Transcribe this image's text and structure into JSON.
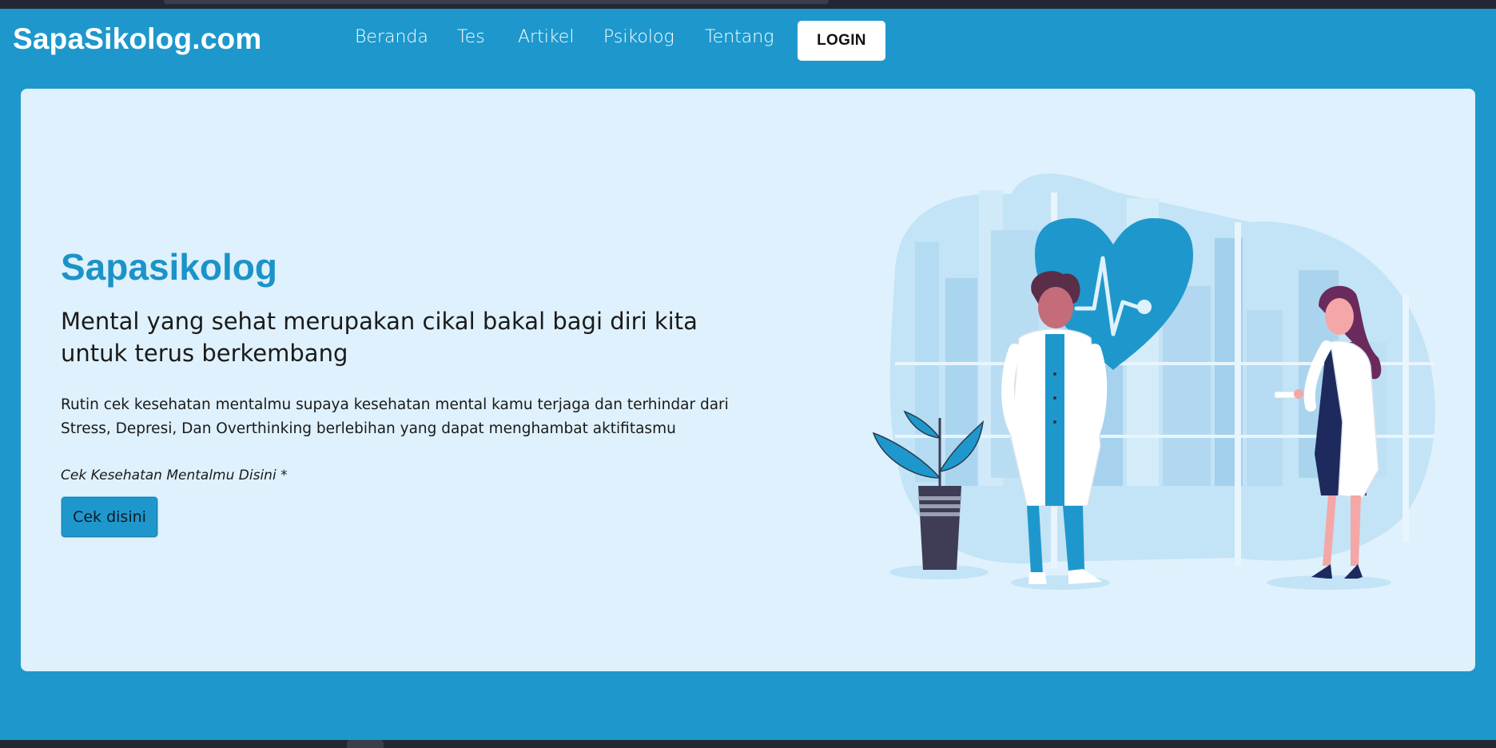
{
  "header": {
    "brand": "SapaSikolog.com",
    "nav": [
      "Beranda",
      "Tes",
      "Artikel",
      "Psikolog",
      "Tentang"
    ],
    "login_label": "LOGIN"
  },
  "hero": {
    "title": "Sapasikolog",
    "subtitle": "Mental yang sehat merupakan cikal bakal bagi diri kita untuk terus berkembang",
    "description": "Rutin cek kesehatan mentalmu supaya kesehatan mental kamu terjaga dan terhindar dari Stress, Depresi, Dan Overthinking berlebihan yang dapat menghambat aktifitasmu",
    "note": "Cek Kesehatan Mentalmu Disini *",
    "cta_label": "Cek disini"
  },
  "colors": {
    "brand_blue": "#1e98cc",
    "hero_bg": "#dff1fc",
    "title_blue": "#1b93c8"
  },
  "illustration": {
    "icons": [
      "heart-pulse-icon",
      "doctor-male-figure",
      "doctor-female-figure",
      "potted-plant"
    ]
  }
}
